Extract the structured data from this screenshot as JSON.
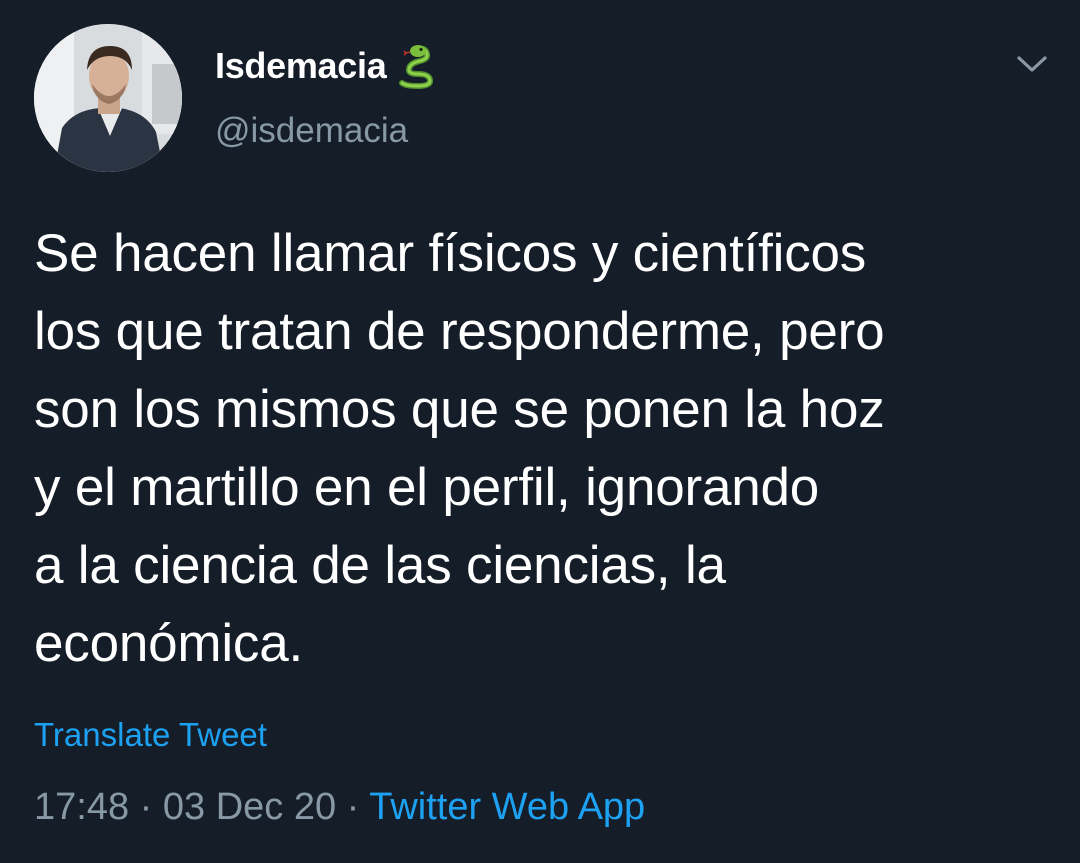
{
  "author": {
    "display_name": "Isdemacia",
    "emoji": "snake",
    "handle": "@isdemacia"
  },
  "icons": {
    "more": "chevron-down-icon",
    "emoji": "snake-icon"
  },
  "tweet": {
    "lines": [
      "Se hacen llamar físicos y científicos",
      "los que tratan de responderme, pero",
      "son los mismos que se ponen la hoz",
      "y el martillo en el perfil, ignorando",
      "a la ciencia de las ciencias, la",
      "económica."
    ]
  },
  "translate_label": "Translate Tweet",
  "meta": {
    "time": "17:48",
    "separator": "·",
    "date": "03 Dec 20",
    "source": "Twitter Web App"
  },
  "colors": {
    "background": "#151d28",
    "text": "#ffffff",
    "muted": "#8899a6",
    "link": "#1da1f2"
  }
}
